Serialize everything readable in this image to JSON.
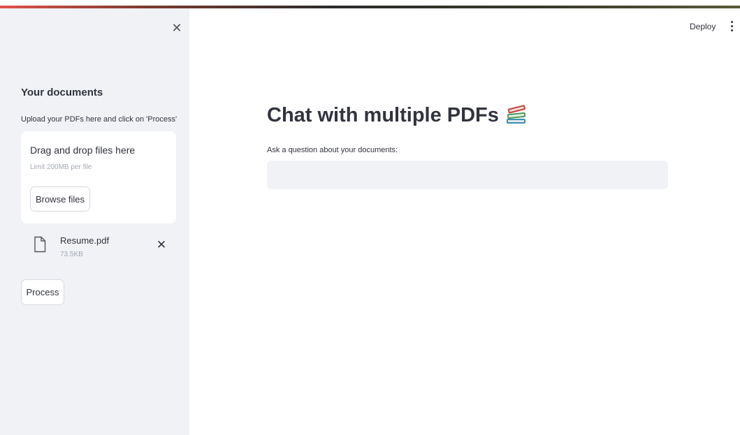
{
  "header": {
    "deploy_label": "Deploy",
    "menu_icon": "kebab-menu-icon"
  },
  "sidebar": {
    "close_icon": "close-icon",
    "title": "Your documents",
    "subtitle": "Upload your PDFs here and click on 'Process'",
    "uploader": {
      "drop_title": "Drag and drop files here",
      "limit_text": "Limit 200MB per file",
      "browse_label": "Browse files"
    },
    "files": [
      {
        "name": "Resume.pdf",
        "size": "73.5KB"
      }
    ],
    "process_label": "Process"
  },
  "main": {
    "title": "Chat with multiple PDFs",
    "title_icon": "books-icon",
    "question_label": "Ask a question about your documents:",
    "question_value": ""
  },
  "colors": {
    "sidebar_bg": "#f0f2f6",
    "text": "#31333f",
    "muted": "#a3a8b4",
    "input_bg": "#f0f2f6"
  }
}
